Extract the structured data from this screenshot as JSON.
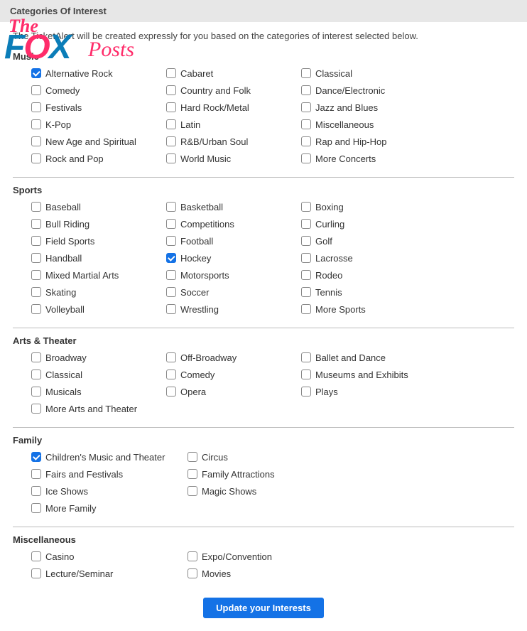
{
  "header": {
    "title": "Categories Of Interest"
  },
  "intro": "The TicketAlert will be created expressly for you based on the categories of interest selected below.",
  "watermark": {
    "the": "The",
    "fox_f": "F",
    "fox_o": "O",
    "fox_x": "X",
    "posts": "Posts"
  },
  "sections": [
    {
      "title": "Music",
      "cols": 3,
      "items": [
        {
          "label": "Alternative Rock",
          "checked": true
        },
        {
          "label": "Cabaret",
          "checked": false
        },
        {
          "label": "Classical",
          "checked": false
        },
        {
          "label": "Comedy",
          "checked": false
        },
        {
          "label": "Country and Folk",
          "checked": false
        },
        {
          "label": "Dance/Electronic",
          "checked": false
        },
        {
          "label": "Festivals",
          "checked": false
        },
        {
          "label": "Hard Rock/Metal",
          "checked": false
        },
        {
          "label": "Jazz and Blues",
          "checked": false
        },
        {
          "label": "K-Pop",
          "checked": false
        },
        {
          "label": "Latin",
          "checked": false
        },
        {
          "label": "Miscellaneous",
          "checked": false
        },
        {
          "label": "New Age and Spiritual",
          "checked": false
        },
        {
          "label": "R&B/Urban Soul",
          "checked": false
        },
        {
          "label": "Rap and Hip-Hop",
          "checked": false
        },
        {
          "label": "Rock and Pop",
          "checked": false
        },
        {
          "label": "World Music",
          "checked": false
        },
        {
          "label": "More Concerts",
          "checked": false
        }
      ]
    },
    {
      "title": "Sports",
      "cols": 3,
      "items": [
        {
          "label": "Baseball",
          "checked": false
        },
        {
          "label": "Basketball",
          "checked": false
        },
        {
          "label": "Boxing",
          "checked": false
        },
        {
          "label": "Bull Riding",
          "checked": false
        },
        {
          "label": "Competitions",
          "checked": false
        },
        {
          "label": "Curling",
          "checked": false
        },
        {
          "label": "Field Sports",
          "checked": false
        },
        {
          "label": "Football",
          "checked": false
        },
        {
          "label": "Golf",
          "checked": false
        },
        {
          "label": "Handball",
          "checked": false
        },
        {
          "label": "Hockey",
          "checked": true
        },
        {
          "label": "Lacrosse",
          "checked": false
        },
        {
          "label": "Mixed Martial Arts",
          "checked": false
        },
        {
          "label": "Motorsports",
          "checked": false
        },
        {
          "label": "Rodeo",
          "checked": false
        },
        {
          "label": "Skating",
          "checked": false
        },
        {
          "label": "Soccer",
          "checked": false
        },
        {
          "label": "Tennis",
          "checked": false
        },
        {
          "label": "Volleyball",
          "checked": false
        },
        {
          "label": "Wrestling",
          "checked": false
        },
        {
          "label": "More Sports",
          "checked": false
        }
      ]
    },
    {
      "title": "Arts & Theater",
      "cols": 3,
      "items": [
        {
          "label": "Broadway",
          "checked": false
        },
        {
          "label": "Off-Broadway",
          "checked": false
        },
        {
          "label": "Ballet and Dance",
          "checked": false
        },
        {
          "label": "Classical",
          "checked": false
        },
        {
          "label": "Comedy",
          "checked": false
        },
        {
          "label": "Museums and Exhibits",
          "checked": false
        },
        {
          "label": "Musicals",
          "checked": false
        },
        {
          "label": "Opera",
          "checked": false
        },
        {
          "label": "Plays",
          "checked": false
        },
        {
          "label": "More Arts and Theater",
          "checked": false
        }
      ]
    },
    {
      "title": "Family",
      "cols": 2,
      "items": [
        {
          "label": "Children's Music and Theater",
          "checked": true
        },
        {
          "label": "Circus",
          "checked": false
        },
        {
          "label": "Fairs and Festivals",
          "checked": false
        },
        {
          "label": "Family Attractions",
          "checked": false
        },
        {
          "label": "Ice Shows",
          "checked": false
        },
        {
          "label": "Magic Shows",
          "checked": false
        },
        {
          "label": "More Family",
          "checked": false
        }
      ]
    },
    {
      "title": "Miscellaneous",
      "cols": 2,
      "items": [
        {
          "label": "Casino",
          "checked": false
        },
        {
          "label": "Expo/Convention",
          "checked": false
        },
        {
          "label": "Lecture/Seminar",
          "checked": false
        },
        {
          "label": "Movies",
          "checked": false
        }
      ]
    }
  ],
  "button": {
    "label": "Update your Interests"
  }
}
